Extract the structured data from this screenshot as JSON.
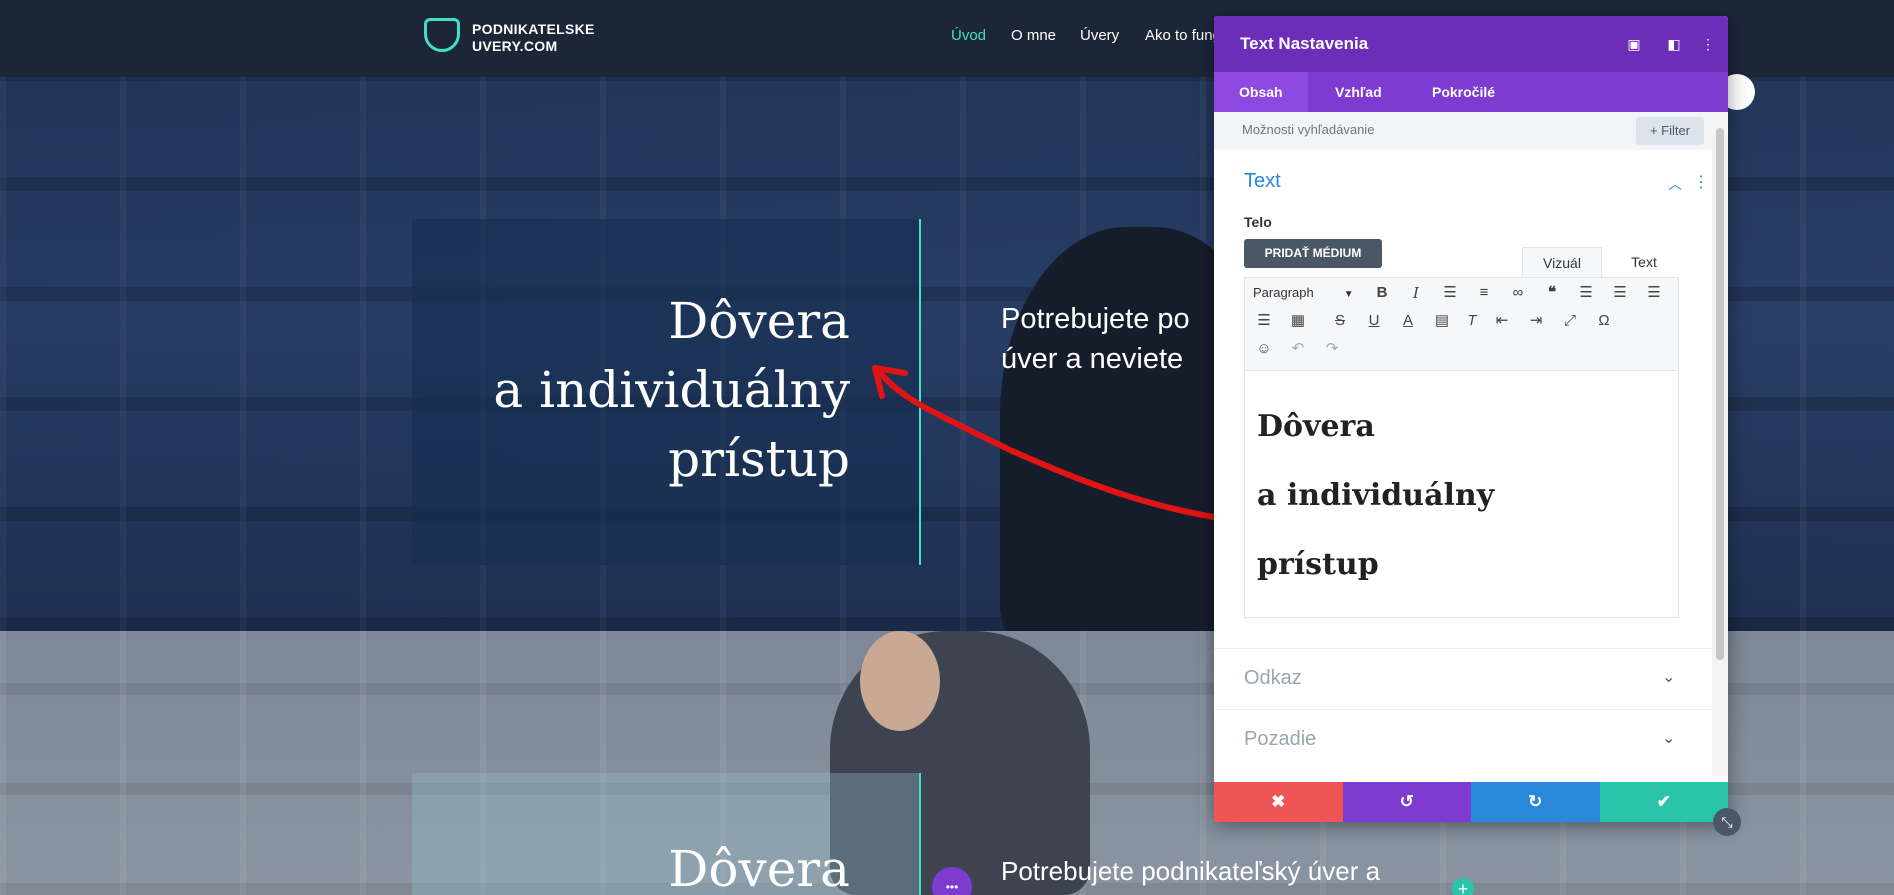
{
  "header": {
    "logo_line1": "PODNIKATELSKE",
    "logo_line2": "UVERY.COM",
    "nav": [
      "Úvod",
      "O mne",
      "Úvery",
      "Ako to fung"
    ]
  },
  "hero": {
    "heading": [
      "Dôvera",
      "a individuálny",
      "prístup"
    ],
    "body_line1": "Potrebujete po",
    "body_line2": "úver a neviete"
  },
  "hero2": {
    "heading": "Dôvera",
    "body_line1": "Potrebujete podnikateľský úver a",
    "dots": "•••",
    "plus": "+"
  },
  "panel": {
    "title": "Text Nastavenia",
    "icons": [
      "fullscreen-icon",
      "dock-icon",
      "more-vertical-icon"
    ],
    "tabs": [
      "Obsah",
      "Vzhľad",
      "Pokročilé"
    ],
    "active_tab": "Obsah",
    "search_placeholder": "Možnosti vyhľadávanie",
    "filter_label": "Filter",
    "section_text": "Text",
    "field_label": "Telo",
    "add_media": "PRIDAŤ MÉDIUM",
    "editor_tabs": [
      "Vizuál",
      "Text"
    ],
    "format_select": "Paragraph",
    "editor_content": [
      "Dôvera",
      "a individuálny",
      "prístup"
    ],
    "sections": [
      "Odkaz",
      "Pozadie"
    ],
    "footer_buttons": [
      "cancel",
      "undo",
      "redo",
      "save"
    ]
  },
  "colors": {
    "accent_teal": "#3fe0c5",
    "panel_purple": "#6c2eb9",
    "tab_purple": "#7d3bd1",
    "link_blue": "#2b87da",
    "cancel_red": "#ef5555",
    "undo_purple": "#7e3bd0",
    "redo_blue": "#2b87da",
    "save_green": "#29c4a9",
    "annotation_red": "#e01414"
  }
}
